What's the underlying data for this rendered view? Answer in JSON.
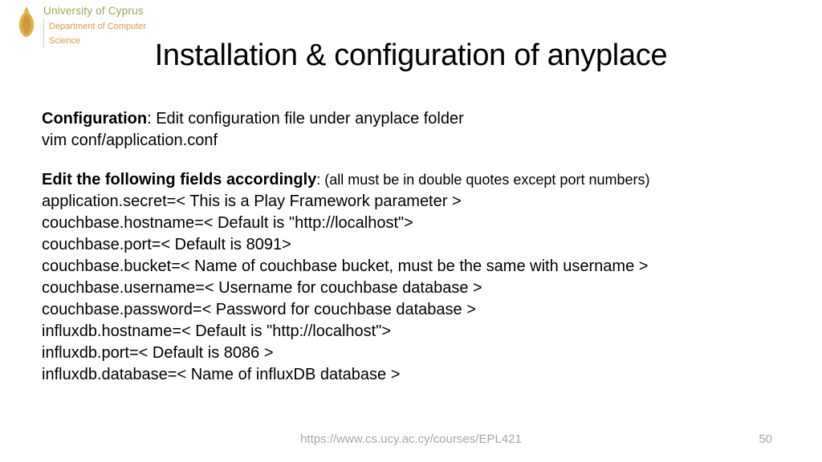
{
  "logo": {
    "university": "University of Cyprus",
    "dept1": "Department of Computer",
    "dept2": "Science"
  },
  "title": "Installation & configuration of anyplace",
  "body": {
    "sec1_label": "Configuration",
    "sec1_rest": ": Edit configuration file under anyplace folder",
    "line_vim": "vim conf/application.conf",
    "sec2_label": "Edit the following fields accordingly",
    "sec2_note": ": (all must be in double quotes except port numbers)",
    "f1": "application.secret=< This is a Play Framework parameter >",
    "f2": "couchbase.hostname=< Default is \"http://localhost\">",
    "f3": "couchbase.port=< Default is 8091>",
    "f4": "couchbase.bucket=< Name of couchbase bucket, must be the same with username >",
    "f5": "couchbase.username=< Username for couchbase database >",
    "f6": "couchbase.password=< Password for couchbase database >",
    "f7": "influxdb.hostname=< Default is \"http://localhost\">",
    "f8": "influxdb.port=< Default is 8086 >",
    "f9": "influxdb.database=< Name of influxDB database >"
  },
  "footer": {
    "url": "https://www.cs.ucy.ac.cy/courses/EPL421",
    "page": "50"
  }
}
